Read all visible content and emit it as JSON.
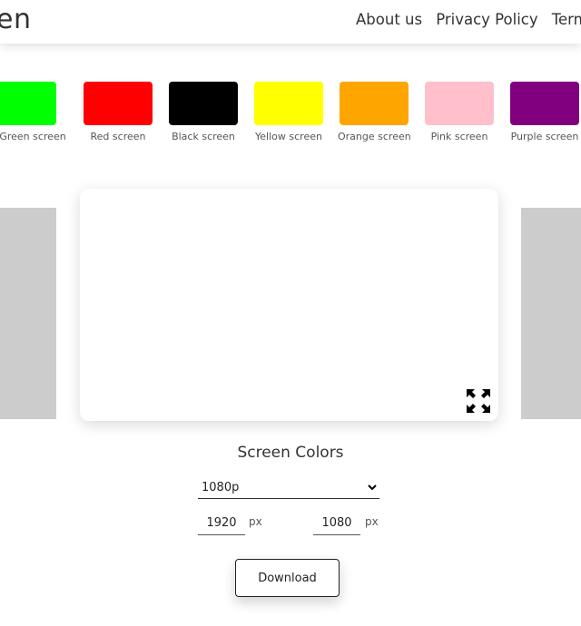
{
  "header": {
    "logo_text": "en",
    "nav": [
      "About us",
      "Privacy Policy",
      "Term"
    ]
  },
  "swatches": [
    {
      "label": "Green screen",
      "color": "#00ff00"
    },
    {
      "label": "Red screen",
      "color": "#ff0000"
    },
    {
      "label": "Black screen",
      "color": "#000000"
    },
    {
      "label": "Yellow screen",
      "color": "#ffff00"
    },
    {
      "label": "Orange screen",
      "color": "#ffa500"
    },
    {
      "label": "Pink screen",
      "color": "#ffc0cb"
    },
    {
      "label": "Purple screen",
      "color": "#800080"
    }
  ],
  "preview": {
    "color": "#ffffff",
    "fullscreen_icon": "fullscreen-icon"
  },
  "controls": {
    "title": "Screen Colors",
    "resolution": "1080p",
    "width": "1920",
    "height": "1080",
    "unit": "px",
    "download_label": "Download"
  }
}
